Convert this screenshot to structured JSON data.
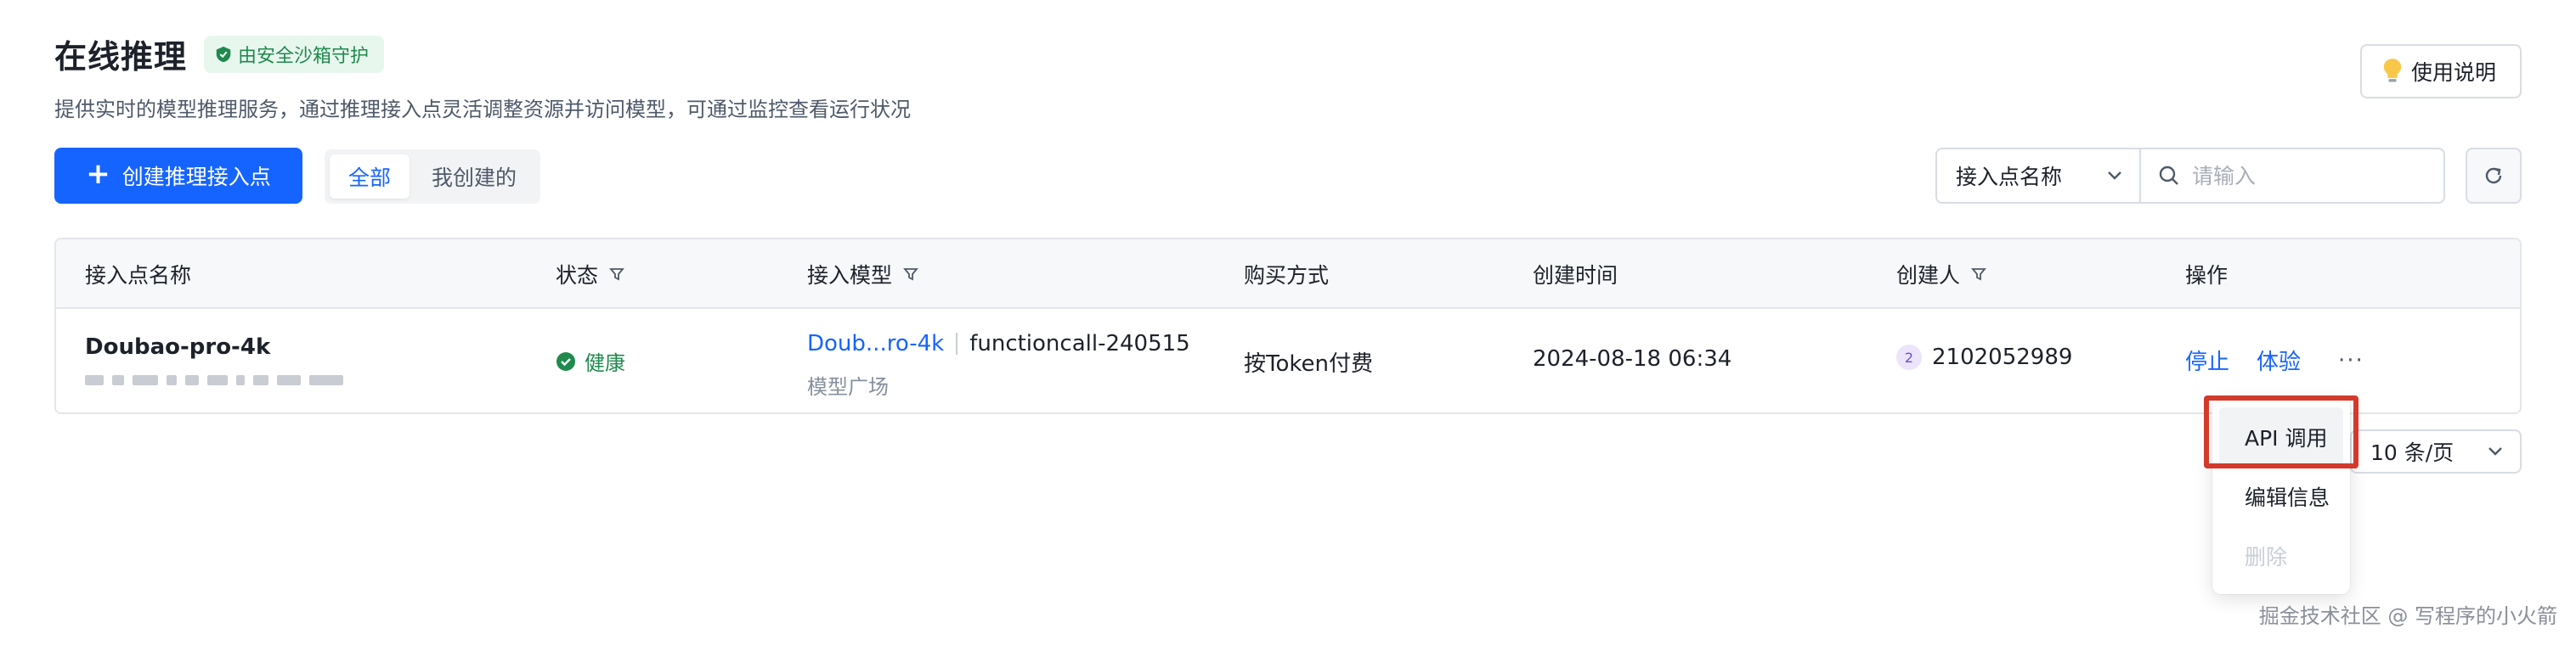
{
  "header": {
    "title": "在线推理",
    "badge": "由安全沙箱守护",
    "subtitle": "提供实时的模型推理服务，通过推理接入点灵活调整资源并访问模型，可通过监控查看运行状况",
    "help_label": "使用说明"
  },
  "toolbar": {
    "create_label": "创建推理接入点",
    "tabs": [
      {
        "label": "全部",
        "active": true
      },
      {
        "label": "我创建的",
        "active": false
      }
    ],
    "filter_field": "接入点名称",
    "search_placeholder": "请输入"
  },
  "table": {
    "columns": [
      "接入点名称",
      "状态",
      "接入模型",
      "购买方式",
      "创建时间",
      "创建人",
      "操作"
    ],
    "rows": [
      {
        "name": "Doubao-pro-4k",
        "status": "健康",
        "model_link": "Doub...ro-4k",
        "model_version": "functioncall-240515",
        "model_source": "模型广场",
        "purchase": "按Token付费",
        "created_at": "2024-08-18 06:34",
        "creator_avatar": "2",
        "creator": "2102052989",
        "op_stop": "停止",
        "op_try": "体验",
        "op_more": "···"
      }
    ]
  },
  "pagination": {
    "page_size": "10 条/页"
  },
  "dropdown": {
    "items": [
      {
        "label": "API 调用",
        "state": "highlight"
      },
      {
        "label": "编辑信息",
        "state": "normal"
      },
      {
        "label": "删除",
        "state": "disabled"
      }
    ]
  },
  "watermark": "掘金技术社区 @ 写程序的小火箭",
  "colors": {
    "primary": "#1664ff",
    "success": "#1f8a4c",
    "annotation": "#d33a2c"
  }
}
